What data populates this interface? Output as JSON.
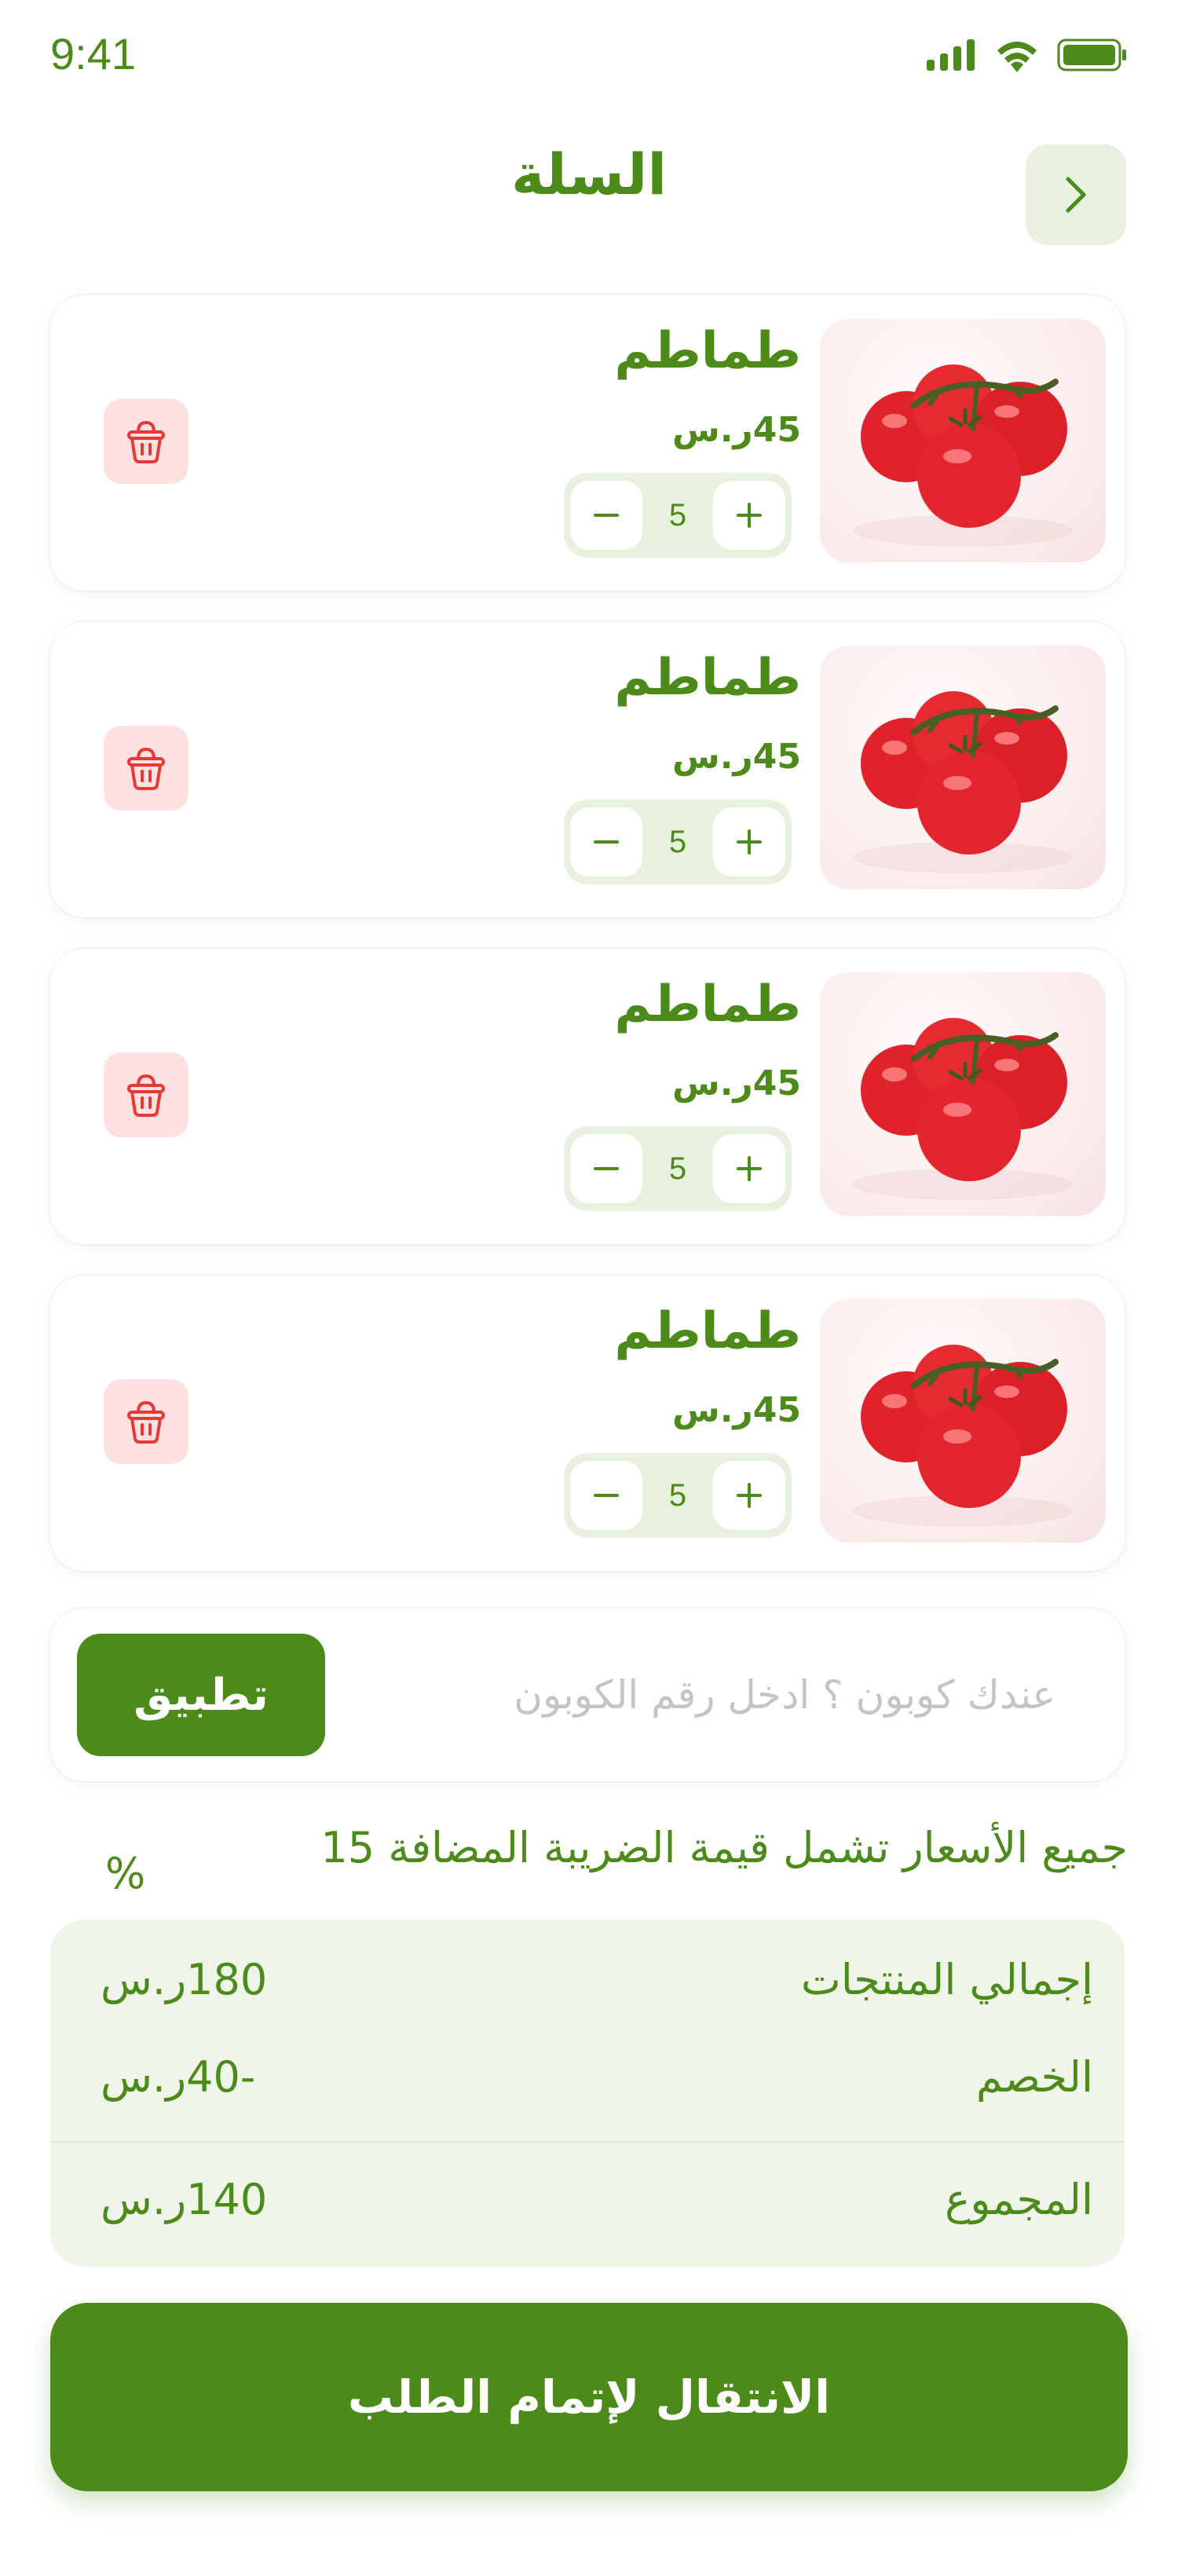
{
  "status_bar": {
    "time": "9:41"
  },
  "header": {
    "title": "السلة"
  },
  "cart": {
    "items": [
      {
        "name": "طماطم",
        "price": "45ر.س",
        "quantity": "5"
      },
      {
        "name": "طماطم",
        "price": "45ر.س",
        "quantity": "5"
      },
      {
        "name": "طماطم",
        "price": "45ر.س",
        "quantity": "5"
      },
      {
        "name": "طماطم",
        "price": "45ر.س",
        "quantity": "5"
      }
    ]
  },
  "coupon": {
    "placeholder": "عندك كوبون ؟ ادخل رقم الكوبون",
    "apply_label": "تطبيق"
  },
  "tax_note": {
    "text": "جميع الأسعار تشمل قيمة الضريبة المضافة 15",
    "percent": "%"
  },
  "summary": {
    "products_total_label": "إجمالي المنتجات",
    "products_total_value": "180ر.س",
    "discount_label": "الخصم",
    "discount_value": "-40ر.س",
    "grand_total_label": "المجموع",
    "grand_total_value": "140ر.س"
  },
  "checkout": {
    "label": "الانتقال لإتمام الطلب"
  },
  "colors": {
    "primary": "#4C8A1A",
    "primary_light": "#E8F1DE",
    "summary_bg": "#EFF5E8",
    "delete_bg": "#FDE1E1",
    "delete_icon": "#E53935"
  },
  "icons": {
    "back": "chevron-right-icon",
    "delete": "trash-basket-icon",
    "increase": "plus-icon",
    "decrease": "minus-icon"
  }
}
